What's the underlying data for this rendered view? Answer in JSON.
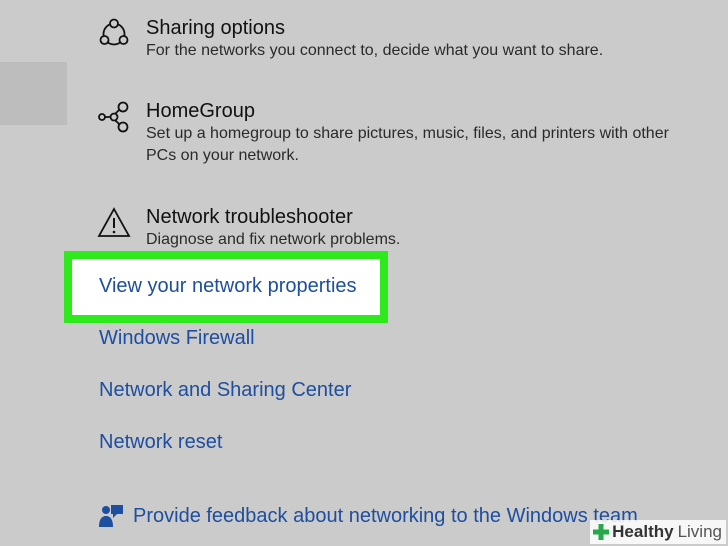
{
  "sections": [
    {
      "icon": "sharing-options-icon",
      "title": "Sharing options",
      "description": "For the networks you connect to, decide what you want to share."
    },
    {
      "icon": "homegroup-icon",
      "title": "HomeGroup",
      "description": "Set up a homegroup to share pictures, music, files, and printers with other PCs on your network."
    },
    {
      "icon": "warning-triangle-icon",
      "title": "Network troubleshooter",
      "description": "Diagnose and fix network problems."
    }
  ],
  "links": {
    "view_properties": "View your network properties",
    "firewall": "Windows Firewall",
    "sharing_center": "Network and Sharing Center",
    "reset": "Network reset"
  },
  "feedback": {
    "icon": "feedback-person-icon",
    "label": "Provide feedback about networking to the Windows team"
  },
  "watermark": {
    "bold": "Healthy",
    "light": "Living"
  },
  "colors": {
    "background": "#cbcbcb",
    "link": "#1e4ea0",
    "highlight_border": "#2eea1d"
  }
}
